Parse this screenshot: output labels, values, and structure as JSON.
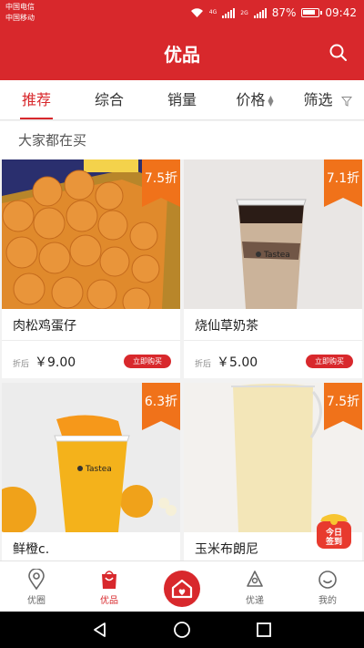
{
  "status": {
    "carrier1": "中国电信",
    "carrier2": "中国移动",
    "net1": "4G",
    "net2": "2G",
    "battery": "87%",
    "time": "09:42"
  },
  "header": {
    "title": "优品"
  },
  "filters": [
    {
      "label": "推荐"
    },
    {
      "label": "综合"
    },
    {
      "label": "销量"
    },
    {
      "label": "价格"
    },
    {
      "label": "筛选"
    }
  ],
  "section": {
    "title": "大家都在买"
  },
  "products": [
    {
      "name": "肉松鸡蛋仔",
      "discount": "7.5折",
      "price_label": "折后",
      "price": "￥9.00",
      "buy_label": "立即购买"
    },
    {
      "name": "烧仙草奶茶",
      "discount": "7.1折",
      "price_label": "折后",
      "price": "￥5.00",
      "buy_label": "立即购买",
      "brand": "Tastea"
    },
    {
      "name": "鲜橙c.",
      "discount": "6.3折",
      "brand": "Tastea"
    },
    {
      "name": "玉米布朗尼",
      "discount": "7.5折"
    }
  ],
  "checkin": {
    "line1": "今日",
    "line2": "签到"
  },
  "bottom_nav": [
    {
      "label": "优圈",
      "icon": "location-pin-icon"
    },
    {
      "label": "优品",
      "icon": "shopping-bag-icon"
    },
    {
      "label": "",
      "icon": "home-heart-icon"
    },
    {
      "label": "优递",
      "icon": "delivery-icon"
    },
    {
      "label": "我的",
      "icon": "smiley-icon"
    }
  ],
  "colors": {
    "brand": "#d8282c",
    "discount": "#f0721a"
  }
}
